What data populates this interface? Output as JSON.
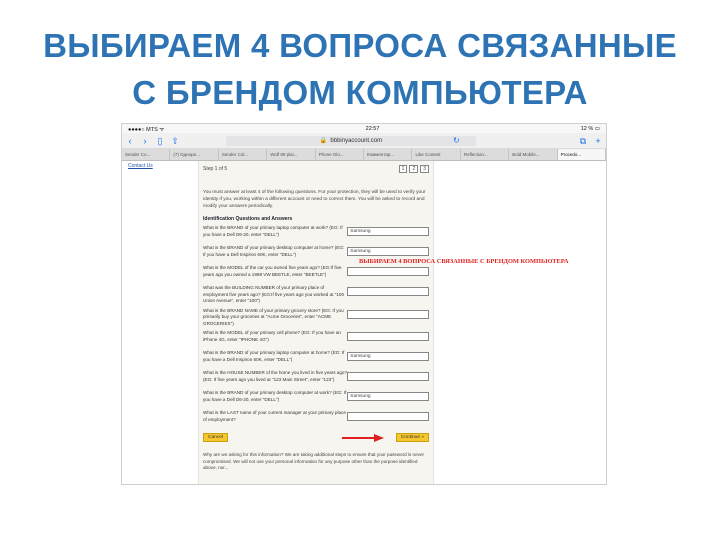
{
  "slide": {
    "title_line1": "ВЫБИРАЕМ 4 ВОПРОСА СВЯЗАННЫЕ",
    "title_line2": "С БРЕНДОМ КОМПЬЮТЕРА"
  },
  "status": {
    "carrier": "●●●●○ MTS ᯤ",
    "time": "22:57",
    "battery": "12 % ▭"
  },
  "browser": {
    "url": "bbbinyaccount.com",
    "tabs": [
      "Sender Co...",
      "(7) Одноре...",
      "Sender Col...",
      "Wolf 89 plai...",
      "Phone Glo...",
      "Комментар...",
      "Like Contest",
      "Reflection...",
      "Bold Mobile...",
      "Procedo..."
    ]
  },
  "page": {
    "contact_link": "Contact Us",
    "step": "Step 1 of 5",
    "pages": [
      "1",
      "2",
      "3"
    ],
    "intro": "You must answer at least 4 of the following questions. For your protection, they will be used to verify your identity if you, working within a different account or need to correct them. You will be asked to record and modify your answers periodically.",
    "section_title": "Identification Questions and Answers",
    "callout": "ВЫБИРАЕМ 4 ВОПРОСА СВЯЗАННЫЕ С БРЕНДОМ КОМПЬЮТЕРА",
    "questions": [
      {
        "text": "What is the BRAND of your primary laptop computer at work? (EG: If you have a Dell D6-20, enter \"DELL\")",
        "answer": "Samsung"
      },
      {
        "text": "What is the BRAND of your primary desktop computer at home? (EG: If you have a Dell Inspiron 60K, enter \"DELL\")",
        "answer": "Samsung"
      },
      {
        "text": "What is the MODEL of the car you owned five years ago? (EG:If five years ago you owned a 1998 VW BEETLE, enter \"BEETLE\")",
        "answer": ""
      },
      {
        "text": "What was the BUILDING NUMBER of your primary place of employment five years ago? (EG:If five years ago you worked at \"100 Union Avenue\", enter \"100\")",
        "answer": ""
      },
      {
        "text": "What is the BRAND NAME of your primary grocery store? (EG: If you primarily buy your groceries at \"Acme Groceries\", enter \"ACME GROCERIES\")",
        "answer": ""
      },
      {
        "text": "What is the MODEL of your primary cell phone? (EG: If you have an iPhone 4G, enter \"IPHONE 4G\")",
        "answer": ""
      },
      {
        "text": "What is the BRAND of your primary laptop computer at home? (EG: If you have a Dell Inspiron 60K, enter \"DELL\")",
        "answer": "Samsung"
      },
      {
        "text": "What is the HOUSE NUMBER of the home you lived in five years ago? (EG: If five years ago you lived at \"123 Main Street\", enter \"123\")",
        "answer": ""
      },
      {
        "text": "What is the BRAND of your primary desktop computer at work? (EG: If you have a Dell D6-20, enter \"DELL\")",
        "answer": "Samsung"
      },
      {
        "text": "What is the LAST name of your current manager at your primary place of employment?",
        "answer": ""
      }
    ],
    "cancel_label": "Cancel",
    "continue_label": "Continue »",
    "footer": "Why are we asking for this information? We are taking additional steps to ensure that your password is never compromised. We will not use your personal information for any purpose other than the purpose identified above, nor..."
  }
}
